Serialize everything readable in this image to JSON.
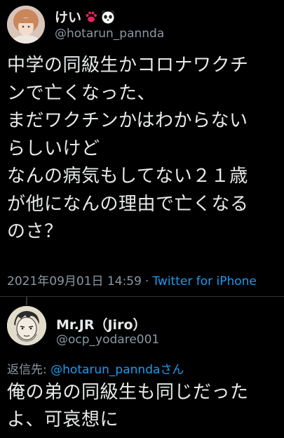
{
  "main_tweet": {
    "display_name": "けい",
    "name_emojis": [
      "paw-emoji",
      "panda-emoji"
    ],
    "handle": "@hotarun_pannda",
    "text": "中学の同級生かコロナワクチ\nンで亡くなった、\nまだワクチンかはわからない\nらしいけど\nなんの病気もしてない２１歳\nが他になんの理由で亡くなる\nのさ？",
    "timestamp": "2021年09月01日 14:59",
    "separator": "·",
    "client": "Twitter for iPhone",
    "avatar": "profile-photo"
  },
  "reply": {
    "display_name": "Mr.JR（Jiro）",
    "handle": "@ocp_yodare001",
    "replying_prefix": "返信先: ",
    "replying_handle": "@hotarun_pannda",
    "replying_suffix": "さん",
    "text": "俺の弟の同級生も同じだった\nよ、可哀想に",
    "avatar": "manga-drawing"
  },
  "colors": {
    "background": "#000000",
    "text": "#e7e9ea",
    "secondary": "#8b98a5",
    "link": "#1d9bf0",
    "divider": "#2f3336"
  }
}
